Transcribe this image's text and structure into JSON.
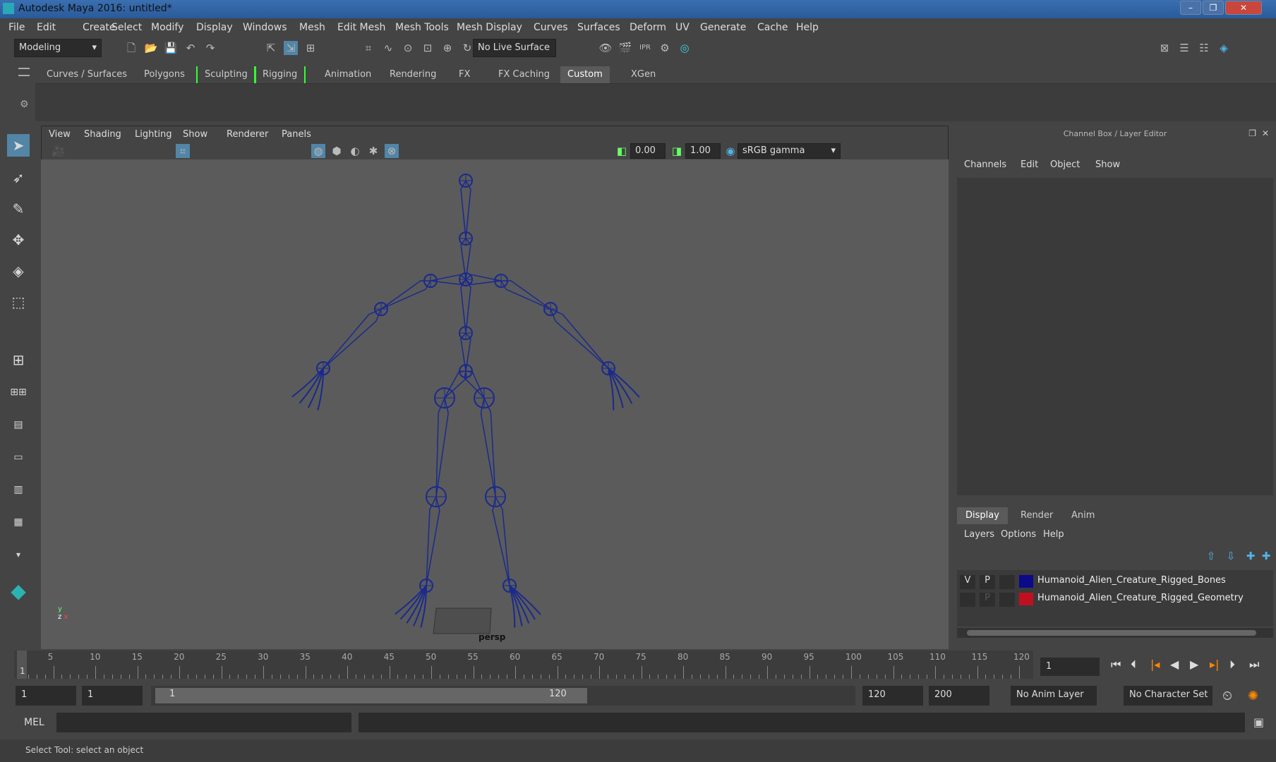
{
  "window": {
    "title": "Autodesk Maya 2016: untitled*",
    "min": "–",
    "max": "❐",
    "close": "✕"
  },
  "menubar": [
    "File",
    "Edit",
    "Create",
    "Select",
    "Modify",
    "Display",
    "Windows",
    "Mesh",
    "Edit Mesh",
    "Mesh Tools",
    "Mesh Display",
    "Curves",
    "Surfaces",
    "Deform",
    "UV",
    "Generate",
    "Cache",
    "Help"
  ],
  "toolbar": {
    "mode": "Modeling",
    "live_surface": "No Live Surface"
  },
  "shelf_tabs": [
    "Curves / Surfaces",
    "Polygons",
    "Sculpting",
    "Rigging",
    "Animation",
    "Rendering",
    "FX",
    "FX Caching",
    "Custom",
    "XGen"
  ],
  "shelf_active": "Custom",
  "viewport": {
    "menus": [
      "View",
      "Shading",
      "Lighting",
      "Show",
      "Renderer",
      "Panels"
    ],
    "exposure": "0.00",
    "gamma": "1.00",
    "color_space": "sRGB gamma",
    "camera_label": "persp",
    "bone_color": "#1a2a8c"
  },
  "channel_box": {
    "title": "Channel Box / Layer Editor",
    "menus": [
      "Channels",
      "Edit",
      "Object",
      "Show"
    ]
  },
  "layer_editor": {
    "tabs": [
      "Display",
      "Render",
      "Anim"
    ],
    "active_tab": "Display",
    "menus": [
      "Layers",
      "Options",
      "Help"
    ],
    "layers": [
      {
        "v": "V",
        "p": "P",
        "color": "#0a0a8a",
        "name": "Humanoid_Alien_Creature_Rigged_Bones"
      },
      {
        "v": "",
        "p": "P",
        "color": "#c01020",
        "name": "Humanoid_Alien_Creature_Rigged_Geometry"
      }
    ]
  },
  "timeslider": {
    "ticks": [
      "5",
      "10",
      "15",
      "20",
      "25",
      "30",
      "35",
      "40",
      "45",
      "50",
      "55",
      "60",
      "65",
      "70",
      "75",
      "80",
      "85",
      "90",
      "95",
      "100",
      "105",
      "110",
      "115",
      "120"
    ],
    "current_frame_label": "1",
    "current_frame": "1"
  },
  "range": {
    "start": "1",
    "playback_start": "1",
    "slider_start": "1",
    "slider_end": "120",
    "playback_end": "120",
    "end": "200",
    "anim_layer": "No Anim Layer",
    "character_set": "No Character Set"
  },
  "command": {
    "lang": "MEL"
  },
  "status": "Select Tool: select an object"
}
